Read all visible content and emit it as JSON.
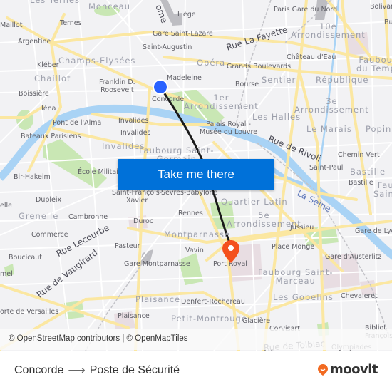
{
  "map": {
    "origin_marker": {
      "label": "Concorde",
      "color": "#2962ff"
    },
    "destination_marker": {
      "label": "Port Royal",
      "color": "#f4511e"
    },
    "route_color": "#1a1a1a",
    "neighborhoods": [
      {
        "id": "monceau",
        "text": "Monceau"
      },
      {
        "id": "champs",
        "text": "Champs-Elysées"
      },
      {
        "id": "chaillot",
        "text": "Chaillot"
      },
      {
        "id": "opera",
        "text": "Opéra"
      },
      {
        "id": "arr10",
        "text": "10e\nArrondissement"
      },
      {
        "id": "faubourg-temple",
        "text": "Faubourg\ndu Temple"
      },
      {
        "id": "sentier",
        "text": "Sentier"
      },
      {
        "id": "republique",
        "text": "République"
      },
      {
        "id": "arr1",
        "text": "1er\nArrondissement"
      },
      {
        "id": "arr3",
        "text": "3e\nArrondissement"
      },
      {
        "id": "les-halles",
        "text": "Les Halles"
      },
      {
        "id": "le-marais",
        "text": "Le Marais"
      },
      {
        "id": "popinc",
        "text": "Popinc"
      },
      {
        "id": "invalides-d",
        "text": "Invalides"
      },
      {
        "id": "faubourg-st-germain",
        "text": "Faubourg Saint-\nGermain"
      },
      {
        "id": "bastille-d",
        "text": "Bastille"
      },
      {
        "id": "faubourg-st-antoine",
        "text": "Fau\nSaint"
      },
      {
        "id": "grenelle",
        "text": "Grenelle"
      },
      {
        "id": "quartier-latin",
        "text": "Quartier Latin"
      },
      {
        "id": "arr5",
        "text": "5e\nArrondissement"
      },
      {
        "id": "montparnasse",
        "text": "Montparnasse"
      },
      {
        "id": "faubourg-st-marceau",
        "text": "Faubourg Saint-\nMarceau"
      },
      {
        "id": "plaisance-d",
        "text": "Plaisance"
      },
      {
        "id": "petit-montrouge",
        "text": "Petit-Montrouge"
      },
      {
        "id": "les-gobelins",
        "text": "Les Gobelins"
      },
      {
        "id": "les-ternes",
        "text": "Les Ternes"
      }
    ],
    "stations": [
      {
        "id": "maillot",
        "text": "Maillot"
      },
      {
        "id": "ternes",
        "text": "Ternes"
      },
      {
        "id": "argentine",
        "text": "Argentine"
      },
      {
        "id": "kleber",
        "text": "Kléber"
      },
      {
        "id": "boissiere",
        "text": "Boissière"
      },
      {
        "id": "iena",
        "text": "Iéna"
      },
      {
        "id": "liege",
        "text": "Liège"
      },
      {
        "id": "gare-st-lazare",
        "text": "Gare Saint-Lazare"
      },
      {
        "id": "st-augustin",
        "text": "Saint-Augustin"
      },
      {
        "id": "madeleine",
        "text": "Madeleine"
      },
      {
        "id": "franklin",
        "text": "Franklin D.\nRoosevelt"
      },
      {
        "id": "concorde",
        "text": "Concorde"
      },
      {
        "id": "gare-nord",
        "text": "Paris Gare du Nord"
      },
      {
        "id": "bolivar",
        "text": "Bolivar"
      },
      {
        "id": "bu",
        "text": "Bu"
      },
      {
        "id": "chateau-eau",
        "text": "Château d'Eau"
      },
      {
        "id": "grands-blvd",
        "text": "Grands Boulevards"
      },
      {
        "id": "bourse",
        "text": "Bourse"
      },
      {
        "id": "palais-royal",
        "text": "Palais Royal -\nMusée du Louvre"
      },
      {
        "id": "pont-alma",
        "text": "Pont de l'Alma"
      },
      {
        "id": "invalides-1",
        "text": "Invalides"
      },
      {
        "id": "invalides-2",
        "text": "Invalides"
      },
      {
        "id": "bateaux",
        "text": "Bateaux Parisiens"
      },
      {
        "id": "ecole-mil",
        "text": "École Militaire"
      },
      {
        "id": "bir-hakeim",
        "text": "Bir-Hakeim"
      },
      {
        "id": "dupleix",
        "text": "Dupleix"
      },
      {
        "id": "chemin-vert",
        "text": "Chemin Vert"
      },
      {
        "id": "saint-paul",
        "text": "Saint-Paul"
      },
      {
        "id": "bastille",
        "text": "Bastille"
      },
      {
        "id": "st-francois",
        "text": "Saint-François-\nXavier"
      },
      {
        "id": "sevres",
        "text": "Sèvres-Babylone"
      },
      {
        "id": "rennes",
        "text": "Rennes"
      },
      {
        "id": "duroc",
        "text": "Duroc"
      },
      {
        "id": "cambronne",
        "text": "Cambronne"
      },
      {
        "id": "commerce",
        "text": "Commerce"
      },
      {
        "id": "boucicaut",
        "text": "Boucicaut"
      },
      {
        "id": "pasteur",
        "text": "Pasteur"
      },
      {
        "id": "gare-montparnasse",
        "text": "Gare Montparnasse"
      },
      {
        "id": "vavin",
        "text": "Vavin"
      },
      {
        "id": "port-royal",
        "text": "Port Royal"
      },
      {
        "id": "jussieu",
        "text": "Jussieu"
      },
      {
        "id": "place-monge",
        "text": "Place Monge"
      },
      {
        "id": "gare-lyon",
        "text": "Gare de Lyon"
      },
      {
        "id": "gare-austerlitz",
        "text": "Gare d'Austerlitz"
      },
      {
        "id": "chevaleret",
        "text": "Chevaleret"
      },
      {
        "id": "porte-versailles",
        "text": "orte de Versailles"
      },
      {
        "id": "plaisance",
        "text": "Plaisance"
      },
      {
        "id": "denfert",
        "text": "Denfert-Rochereau"
      },
      {
        "id": "glaciere",
        "text": "Glacière"
      },
      {
        "id": "corvisart",
        "text": "Corvisart"
      },
      {
        "id": "biblio",
        "text": "Bibliot\nFrançois M"
      },
      {
        "id": "olympiades",
        "text": "Olympiades"
      },
      {
        "id": "elle",
        "text": "elle"
      },
      {
        "id": "mel",
        "text": "mel"
      }
    ],
    "streets": [
      {
        "id": "rue-la-fayette",
        "text": "Rue La Fayette"
      },
      {
        "id": "rue-rivoli",
        "text": "Rue de Rivoli"
      },
      {
        "id": "rue-lecourbe",
        "text": "Rue Lecourbe"
      },
      {
        "id": "rue-vaugirard",
        "text": "Rue de Vaugirard"
      },
      {
        "id": "rue-tolbiac",
        "text": "Rue de Tolbiac"
      },
      {
        "id": "la-seine",
        "text": "La Seine"
      },
      {
        "id": "ome",
        "text": "ome"
      }
    ]
  },
  "cta": {
    "label": "Take me there"
  },
  "attribution": "© OpenStreetMap contributors | © OpenMapTiles",
  "footer": {
    "origin": "Concorde",
    "arrow": "⟶",
    "destination": "Poste de Sécurité",
    "brand": "moovit",
    "brand_color": "#f26a21"
  }
}
